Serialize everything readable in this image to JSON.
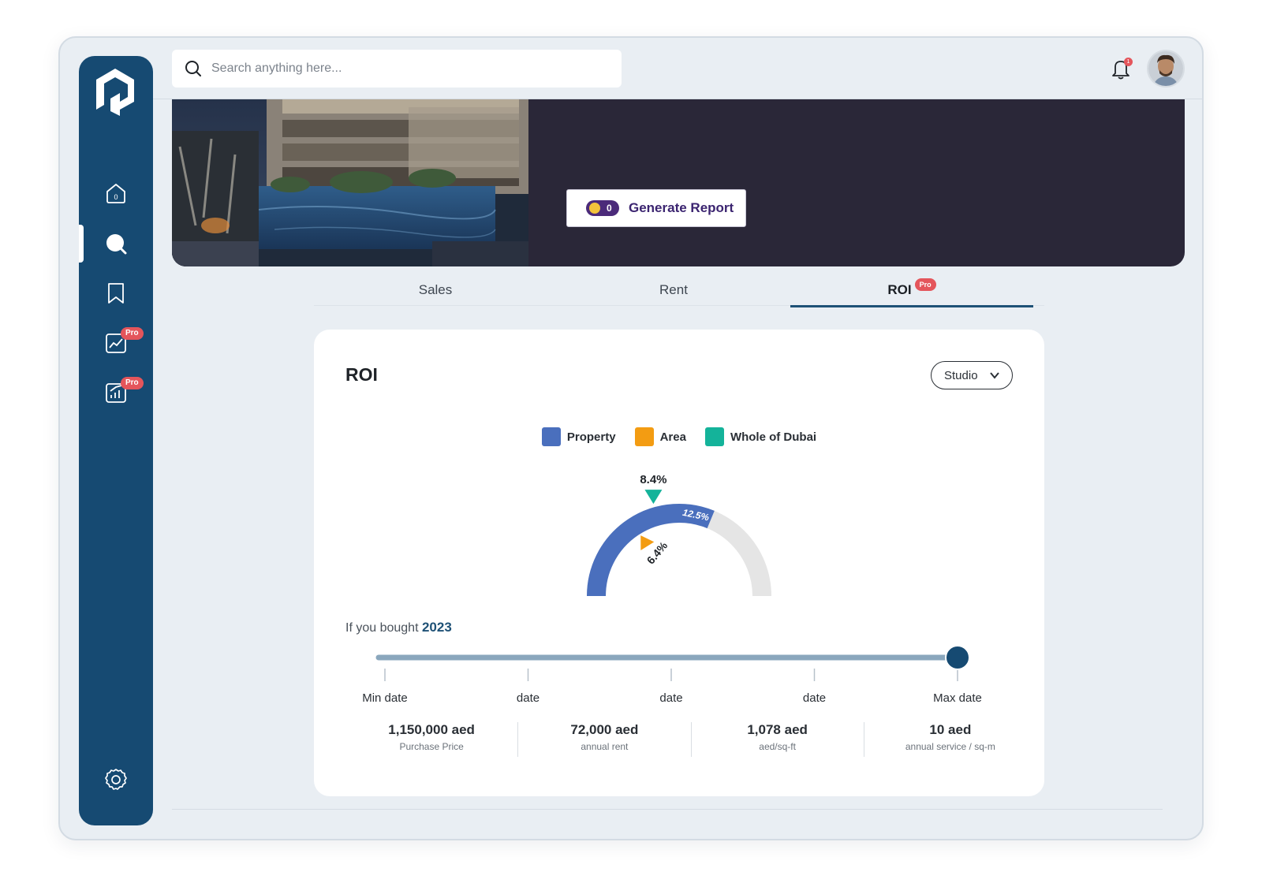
{
  "search": {
    "placeholder": "Search anything here..."
  },
  "header": {
    "notification_count": "1"
  },
  "sidebar": {
    "items": [
      {
        "icon": "home-icon",
        "label": "0",
        "pro": ""
      },
      {
        "icon": "search-icon",
        "active": true,
        "pro": ""
      },
      {
        "icon": "bookmark-icon",
        "pro": ""
      },
      {
        "icon": "chart-doc-icon",
        "pro": "Pro"
      },
      {
        "icon": "growth-doc-icon",
        "pro": "Pro"
      }
    ],
    "settings_icon": "gear-icon"
  },
  "hero": {
    "credits": "0",
    "generate_label": "Generate Report"
  },
  "tabs": [
    {
      "label": "Sales",
      "active": false
    },
    {
      "label": "Rent",
      "active": false
    },
    {
      "label": "ROI",
      "active": true,
      "badge": "Pro"
    }
  ],
  "roi": {
    "title": "ROI",
    "unit_select": "Studio",
    "legend": [
      {
        "label": "Property",
        "color": "#4a6fbd"
      },
      {
        "label": "Area",
        "color": "#f39c12"
      },
      {
        "label": "Whole of Dubai",
        "color": "#14b39a"
      }
    ],
    "gauge": {
      "property_value": 12.5,
      "property_label": "12.5%",
      "area_value": 6.4,
      "area_label": "6.4%",
      "dubai_value": 8.4,
      "dubai_label": "8.4%",
      "max": 20
    },
    "bought_prefix": "If you bought",
    "bought_year": "2023",
    "slider": {
      "ticks": [
        "Min date",
        "date",
        "date",
        "date",
        "Max date"
      ],
      "value_fraction": 1.0
    },
    "stats": [
      {
        "value": "1,150,000 aed",
        "label": "Purchase Price"
      },
      {
        "value": "72,000 aed",
        "label": "annual rent"
      },
      {
        "value": "1,078 aed",
        "label": "aed/sq-ft"
      },
      {
        "value": "10 aed",
        "label": "annual service / sq-m"
      }
    ]
  },
  "colors": {
    "sidebar": "#164a72",
    "accent": "#1e5176",
    "pro": "#e4555b",
    "hero_bg": "#2a2738"
  }
}
